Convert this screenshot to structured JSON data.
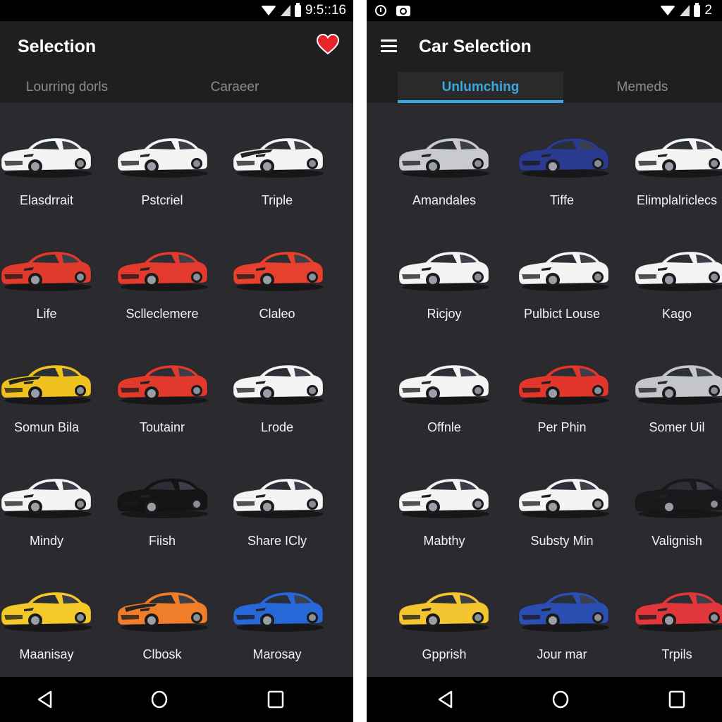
{
  "left_screen": {
    "status_bar": {
      "time": "9:5::16",
      "icons": [
        "wifi-icon",
        "signal-icon",
        "battery-icon"
      ]
    },
    "app_bar": {
      "title": "Selection",
      "action_icon": "heart-icon",
      "accent": "#e8242b"
    },
    "tabs": [
      {
        "label": "Lourring dorls",
        "active": false
      },
      {
        "label": "Caraeer",
        "active": false
      }
    ],
    "cars": [
      {
        "label": "Elasdrrait",
        "color": "#f4f4f4"
      },
      {
        "label": "Pstcriel",
        "color": "#f4f4f4"
      },
      {
        "label": "Triple",
        "color": "#f4f4f4",
        "stripe": "#222222"
      },
      {
        "label": "Life",
        "color": "#e03a2c"
      },
      {
        "label": "Sclleclemere",
        "color": "#e23a2e"
      },
      {
        "label": "Claleo",
        "color": "#e8402e"
      },
      {
        "label": "Somun Bila",
        "color": "#f0c21f",
        "stripe": "#222222"
      },
      {
        "label": "Toutainr",
        "color": "#e2392d"
      },
      {
        "label": "Lrode",
        "color": "#f4f4f4"
      },
      {
        "label": "Mindy",
        "color": "#f4f4f4"
      },
      {
        "label": "Fiish",
        "color": "#141414"
      },
      {
        "label": "Share ICly",
        "color": "#f4f4f4"
      },
      {
        "label": "Maanisay",
        "color": "#f3c92a"
      },
      {
        "label": "Clbosk",
        "color": "#f07d2a",
        "stripe": "#222222"
      },
      {
        "label": "Marosay",
        "color": "#2867d8"
      }
    ]
  },
  "right_screen": {
    "status_bar": {
      "time": "2",
      "left_icons": [
        "alarm-icon",
        "camera-icon"
      ],
      "icons": [
        "wifi-icon",
        "signal-icon",
        "battery-icon"
      ]
    },
    "app_bar": {
      "title": "Car Selection",
      "nav_icon": "menu-icon"
    },
    "tabs": [
      {
        "label": "Unlumching",
        "active": true
      },
      {
        "label": "Memeds",
        "active": false
      }
    ],
    "accent": "#3aa7e0",
    "cars": [
      {
        "label": "Amandales",
        "color": "#c8cace"
      },
      {
        "label": "Tiffe",
        "color": "#2a3a8e"
      },
      {
        "label": "Elimplalriclecs",
        "color": "#f4f4f4"
      },
      {
        "label": "Ricjoy",
        "color": "#f4f4f4"
      },
      {
        "label": "Pulbict Louse",
        "color": "#f4f4f4"
      },
      {
        "label": "Kago",
        "color": "#f4f4f4"
      },
      {
        "label": "Offnle",
        "color": "#f4f4f4"
      },
      {
        "label": "Per Phin",
        "color": "#e2352c"
      },
      {
        "label": "Somer Uil",
        "color": "#c4c6ca"
      },
      {
        "label": "Mabthy",
        "color": "#f4f4f4"
      },
      {
        "label": "Substy Min",
        "color": "#f4f4f4"
      },
      {
        "label": "Valignish",
        "color": "#1a1a1c"
      },
      {
        "label": "Gpprish",
        "color": "#f3c531"
      },
      {
        "label": "Jour mar",
        "color": "#2a4fb0"
      },
      {
        "label": "Trpils",
        "color": "#e0363c"
      }
    ]
  },
  "nav_bar": {
    "buttons": [
      "back-icon",
      "home-icon",
      "recents-icon"
    ]
  }
}
